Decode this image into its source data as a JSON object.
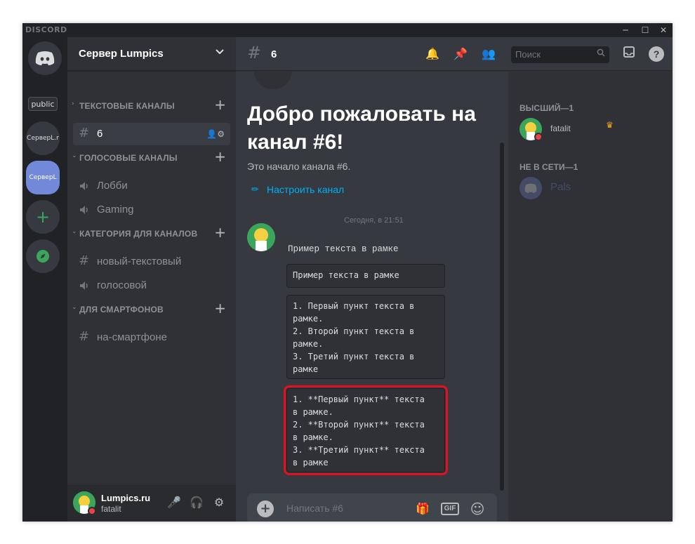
{
  "window": {
    "brand": "DISCORD",
    "controls": [
      "─",
      "☐",
      "✕"
    ]
  },
  "guilds": {
    "home_label": "public",
    "items": [
      {
        "label": "СерверL.r"
      },
      {
        "label": "СерверL"
      }
    ],
    "add_label": "+",
    "explore_label": "⊘"
  },
  "server": {
    "name": "Сервер Lumpics",
    "chevron": "⌄"
  },
  "categories": [
    {
      "label": "ТЕКСТОВЫЕ КАНАЛЫ",
      "arrow": "›",
      "plus": "+"
    },
    {
      "label": "ГОЛОСОВЫЕ КАНАЛЫ",
      "arrow": "⌄",
      "plus": "+"
    },
    {
      "label": "КАТЕГОРИЯ ДЛЯ КАНАЛОВ",
      "arrow": "⌄",
      "plus": "+"
    },
    {
      "label": "ДЛЯ СМАРТФОНОВ",
      "arrow": "⌄",
      "plus": "+"
    }
  ],
  "channels": [
    {
      "label": "6",
      "type": "text",
      "selected": true,
      "icons": "👤⚙"
    },
    {
      "label": "Лобби",
      "type": "voice"
    },
    {
      "label": "Gaming",
      "type": "voice"
    },
    {
      "label": "новый-текстовый",
      "type": "text"
    },
    {
      "label": "голосовой",
      "type": "voice"
    },
    {
      "label": "на-смартфоне",
      "type": "text"
    }
  ],
  "user_panel": {
    "name": "Lumpics.ru",
    "sub": "fatalit",
    "mic_icon": "🎤",
    "headphones_icon": "🎧",
    "settings_icon": "⚙"
  },
  "chat": {
    "channel_name": "6",
    "hash": "#",
    "welcome_title": "Добро пожаловать на канал #6!",
    "welcome_sub": "Это начало канала #6.",
    "customize_label": "Настроить канал",
    "message": {
      "timestamp": "Сегодня, в 21:51",
      "text": "Пример текста в рамке",
      "code1": "Пример текста в рамке",
      "code2": "1. Первый пункт текста в\nрамке.\n2. Второй пункт текста в\nрамке.\n3. Третий пункт текста в\nрамке",
      "code3": "1. **Первый пункт** текста\nв рамке.\n2. **Второй пункт** текста\nв рамке.\n3. **Третий пункт** текста\nв рамке"
    },
    "composer_placeholder": "Написать #6",
    "composer_plus": "+",
    "gift_icon": "🎁",
    "gif_label": "GIF",
    "emoji_icon": "☺"
  },
  "header_icons": {
    "bell": "🔔",
    "pin": "📌",
    "members": "👥"
  },
  "members": {
    "search_placeholder": "Поиск",
    "search_icon": "🔍",
    "inbox_icon": "▭",
    "help_icon": "?",
    "groups": [
      {
        "title": "ВЫСШИЙ—1",
        "members": [
          {
            "name": "fatalit",
            "crown": "♛",
            "status": "dnd"
          }
        ]
      },
      {
        "title": "НЕ В СЕТИ—1",
        "members": [
          {
            "name": "Pals",
            "status": "offline"
          }
        ]
      }
    ]
  },
  "colors": {
    "accent": "#7289da",
    "link": "#00b0f4",
    "highlight": "#e5101d",
    "dnd": "#ed4245",
    "crown": "#faa61a"
  }
}
